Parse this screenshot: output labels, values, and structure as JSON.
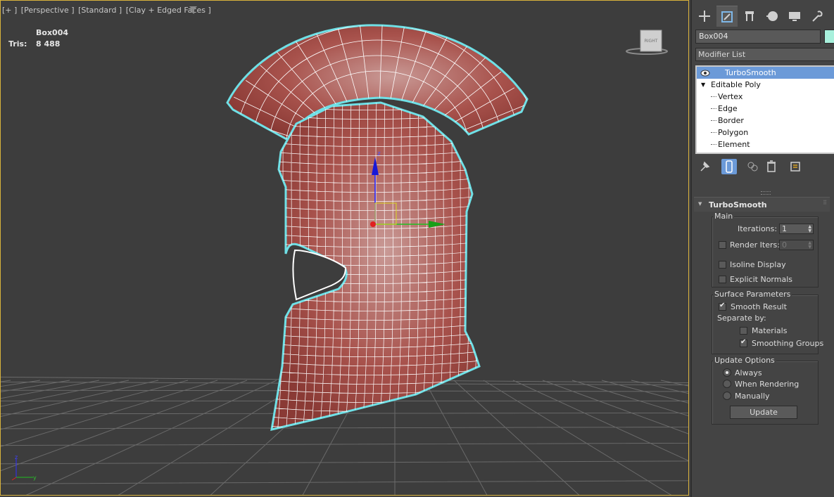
{
  "viewport": {
    "labels": [
      "[+ ]",
      "[Perspective ]",
      "[Standard ]",
      "[Clay + Edged Faces ]"
    ],
    "stats": {
      "object_name": "Box004",
      "tris_label": "Tris:",
      "tris_value": "8 488"
    },
    "viewcube_label": "RIGHT",
    "axis_labels": {
      "z": "z",
      "y": "y"
    }
  },
  "panel": {
    "tabs": [
      {
        "icon": "plus-icon"
      },
      {
        "icon": "modify-icon"
      },
      {
        "icon": "hierarchy-icon"
      },
      {
        "icon": "motion-icon"
      },
      {
        "icon": "display-icon"
      },
      {
        "icon": "utilities-icon"
      }
    ],
    "object_name": "Box004",
    "object_color": "#a8f0dc",
    "modifier_list": "Modifier List",
    "stack": {
      "turbosmooth": "TurboSmooth",
      "editable_poly": "Editable Poly",
      "subobjects": [
        "Vertex",
        "Edge",
        "Border",
        "Polygon",
        "Element"
      ]
    },
    "turbosmooth": {
      "title": "TurboSmooth",
      "main": {
        "label": "Main",
        "iterations_label": "Iterations:",
        "iterations_value": "1",
        "render_iters_label": "Render Iters:",
        "render_iters_value": "0",
        "isoline_label": "Isoline Display",
        "explicit_normals_label": "Explicit Normals"
      },
      "surface": {
        "label": "Surface Parameters",
        "smooth_result_label": "Smooth Result",
        "separate_by_label": "Separate by:",
        "materials_label": "Materials",
        "smoothing_groups_label": "Smoothing Groups"
      },
      "update": {
        "label": "Update Options",
        "always_label": "Always",
        "when_rendering_label": "When Rendering",
        "manually_label": "Manually",
        "update_button": "Update"
      }
    }
  }
}
